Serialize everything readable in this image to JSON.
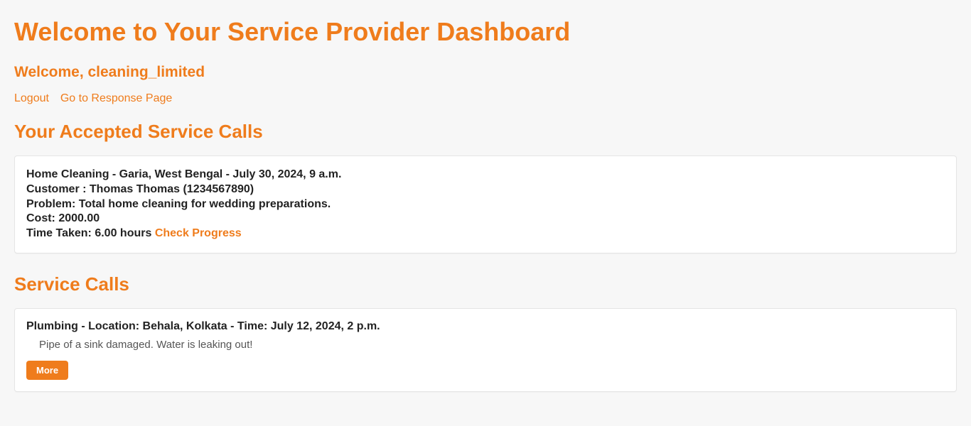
{
  "header": {
    "title": "Welcome to Your Service Provider Dashboard",
    "welcome_prefix": "Welcome, ",
    "username": "cleaning_limited"
  },
  "nav": {
    "logout": "Logout",
    "response_page": "Go to Response Page"
  },
  "accepted": {
    "section_title": "Your Accepted Service Calls",
    "calls": [
      {
        "line1": "Home Cleaning - Garia, West Bengal - July 30, 2024, 9 a.m.",
        "customer_label": "Customer : ",
        "customer_value": "Thomas Thomas (1234567890)",
        "problem_label": "Problem: ",
        "problem_value": "Total home cleaning for wedding preparations.",
        "cost_label": "Cost: ",
        "cost_value": "2000.00",
        "time_label": "Time Taken: ",
        "time_value": "6.00 hours",
        "check_progress": "Check Progress"
      }
    ]
  },
  "service_calls": {
    "section_title": "Service Calls",
    "items": [
      {
        "title": "Plumbing - Location: Behala, Kolkata - Time: July 12, 2024, 2 p.m.",
        "description": "Pipe of a sink damaged. Water is leaking out!",
        "more_label": "More"
      }
    ]
  }
}
